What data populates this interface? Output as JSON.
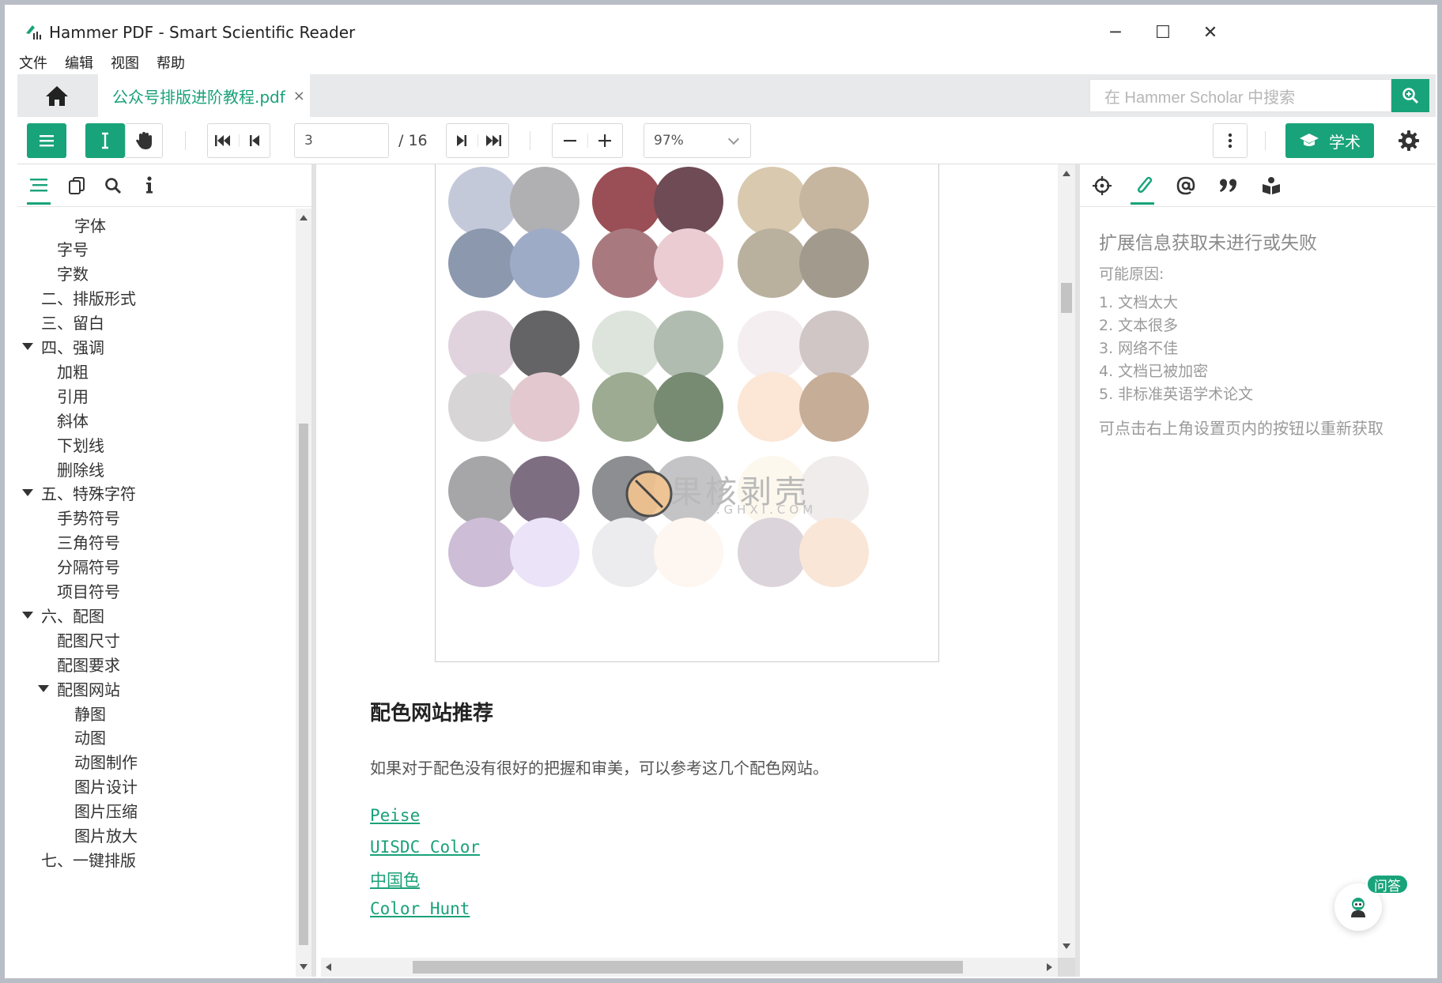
{
  "window": {
    "title": "Hammer PDF - Smart Scientific Reader",
    "minimize": "─",
    "maximize": "☐",
    "close": "✕"
  },
  "menu": [
    "文件",
    "编辑",
    "视图",
    "帮助"
  ],
  "tab": {
    "label": "公众号排版进阶教程.pdf",
    "close": "×"
  },
  "search": {
    "placeholder": "在 Hammer Scholar 中搜索"
  },
  "toolbar": {
    "page_current": "3",
    "page_total": "/ 16",
    "zoom": "97%",
    "academic_label": "学术"
  },
  "outline": [
    {
      "label": "字体",
      "level": 3,
      "expanded": null
    },
    {
      "label": "字号",
      "level": 2,
      "expanded": null
    },
    {
      "label": "字数",
      "level": 2,
      "expanded": null
    },
    {
      "label": "二、排版形式",
      "level": 1,
      "expanded": null
    },
    {
      "label": "三、留白",
      "level": 1,
      "expanded": null
    },
    {
      "label": "四、强调",
      "level": 1,
      "expanded": true
    },
    {
      "label": "加粗",
      "level": 2,
      "expanded": null
    },
    {
      "label": "引用",
      "level": 2,
      "expanded": null
    },
    {
      "label": "斜体",
      "level": 2,
      "expanded": null
    },
    {
      "label": "下划线",
      "level": 2,
      "expanded": null
    },
    {
      "label": "删除线",
      "level": 2,
      "expanded": null
    },
    {
      "label": "五、特殊字符",
      "level": 1,
      "expanded": true
    },
    {
      "label": "手势符号",
      "level": 2,
      "expanded": null
    },
    {
      "label": "三角符号",
      "level": 2,
      "expanded": null
    },
    {
      "label": "分隔符号",
      "level": 2,
      "expanded": null
    },
    {
      "label": "项目符号",
      "level": 2,
      "expanded": null
    },
    {
      "label": "六、配图",
      "level": 1,
      "expanded": true
    },
    {
      "label": "配图尺寸",
      "level": 2,
      "expanded": null
    },
    {
      "label": "配图要求",
      "level": 2,
      "expanded": null
    },
    {
      "label": "配图网站",
      "level": 2,
      "expanded": true
    },
    {
      "label": "静图",
      "level": 3,
      "expanded": null
    },
    {
      "label": "动图",
      "level": 3,
      "expanded": null
    },
    {
      "label": "动图制作",
      "level": 3,
      "expanded": null
    },
    {
      "label": "图片设计",
      "level": 3,
      "expanded": null
    },
    {
      "label": "图片压缩",
      "level": 3,
      "expanded": null
    },
    {
      "label": "图片放大",
      "level": 3,
      "expanded": null
    },
    {
      "label": "七、一键排版",
      "level": 1,
      "expanded": null
    }
  ],
  "document": {
    "swatch_colors": [
      [
        "#c4c9da",
        "#b0afb2",
        "#9a4e55",
        "#6e4b55",
        "#d9c9ae",
        "#c6b59f"
      ],
      [
        "#8c98ae",
        "#9eabc7",
        "#a87a80",
        "#ebccd3",
        "#b9b09e",
        "#a39a8e"
      ],
      [
        "#e1d3de",
        "#646466",
        "#dde4dc",
        "#b0bcaf",
        "#f4eef0",
        "#d0c6c6"
      ],
      [
        "#d8d5d6",
        "#e3c9cf",
        "#9cab91",
        "#778a72",
        "#fce6d5",
        "#c6ad98"
      ],
      [
        "#a6a6a9",
        "#7e6e82",
        "#8d8e92",
        "#c4c4c6",
        "#fdf8ee",
        "#f1ecec"
      ],
      [
        "#cdbdd6",
        "#ebe3f7",
        "#ececef",
        "#fdf6f1",
        "#dcd4db",
        "#fae6d6"
      ]
    ],
    "watermark_text": "果核剥壳",
    "watermark_sub": "WWW.GHXI.COM",
    "heading": "配色网站推荐",
    "body": "如果对于配色没有很好的把握和审美，可以参考这几个配色网站。",
    "links": [
      "Peise",
      "UISDC Color",
      "中国色",
      "Color Hunt"
    ]
  },
  "right_panel": {
    "title": "扩展信息获取未进行或失败",
    "reasons_title": "可能原因:",
    "reasons": [
      "1. 文档太大",
      "2. 文本很多",
      "3. 网络不佳",
      "4. 文档已被加密",
      "5. 非标准英语学术论文"
    ],
    "hint": "可点击右上角设置页内的按钮以重新获取",
    "qa_badge": "问答"
  },
  "colors": {
    "accent": "#19a37a",
    "link": "#1aa179",
    "muted_text": "#9a9a9a"
  }
}
